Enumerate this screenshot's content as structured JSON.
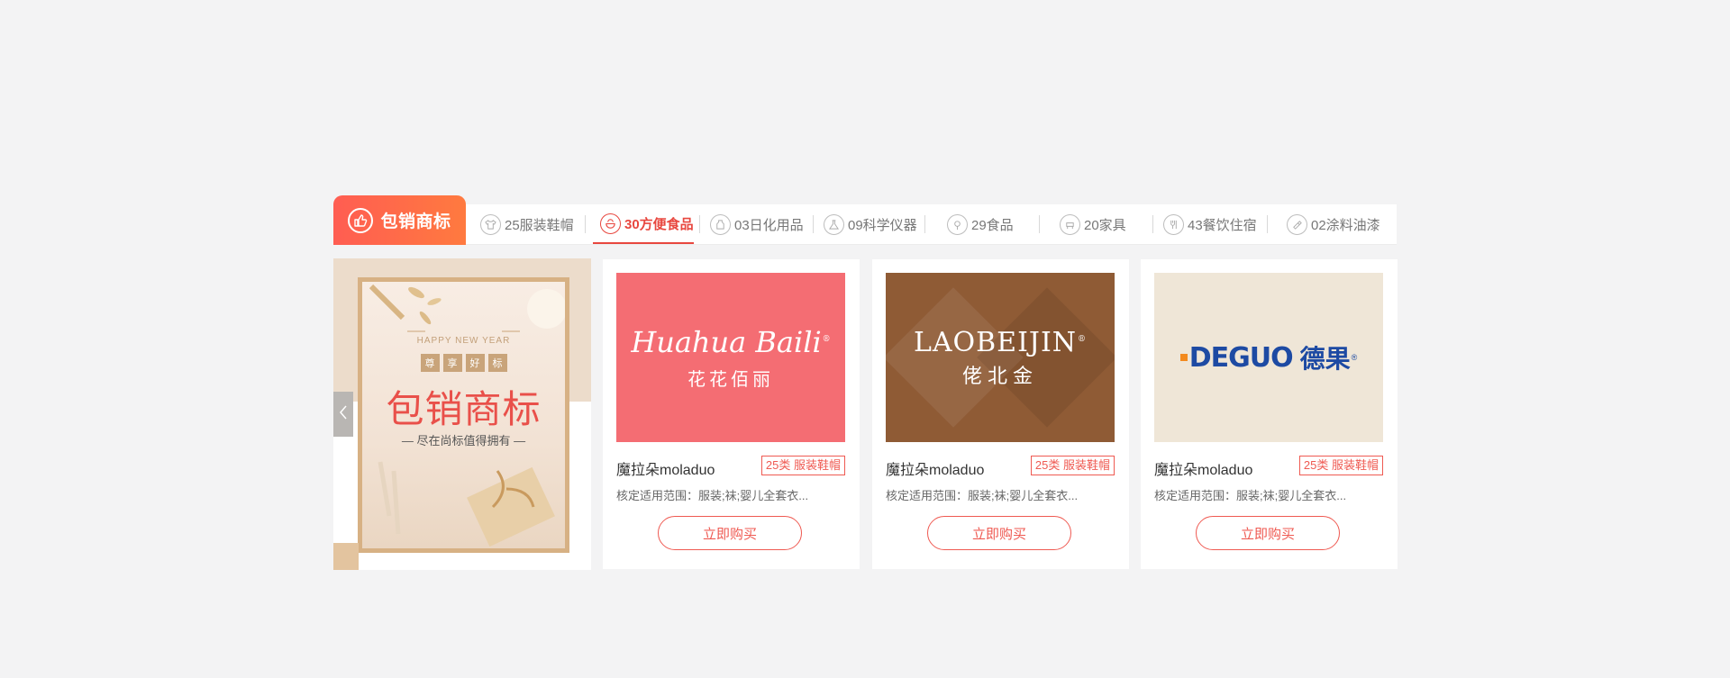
{
  "section": {
    "badge_label": "包销商标",
    "badge_icon": "thumbs-up-icon"
  },
  "tabs": [
    {
      "label": "25服装鞋帽",
      "icon": "shirt-icon",
      "active": false
    },
    {
      "label": "30方便食品",
      "icon": "food-bowl-icon",
      "active": true
    },
    {
      "label": "03日化用品",
      "icon": "bottle-icon",
      "active": false
    },
    {
      "label": "09科学仪器",
      "icon": "flask-icon",
      "active": false
    },
    {
      "label": "29食品",
      "icon": "food-icon",
      "active": false
    },
    {
      "label": "20家具",
      "icon": "furniture-icon",
      "active": false
    },
    {
      "label": "43餐饮住宿",
      "icon": "fork-icon",
      "active": false
    },
    {
      "label": "02涂料油漆",
      "icon": "paint-icon",
      "active": false
    }
  ],
  "banner": {
    "hny": "HAPPY NEW YEAR",
    "enjoy": [
      "尊",
      "享",
      "好",
      "标"
    ],
    "title": "包销商标",
    "subtitle": "— 尽在尚标值得拥有 —"
  },
  "products": [
    {
      "brand_script": "Huahua Baili",
      "brand_cn": "花花佰丽",
      "name": "魔拉朵moladuo",
      "category": "25类 服装鞋帽",
      "scope": "核定适用范围：服装;袜;婴儿全套衣...",
      "buy_label": "立即购买"
    },
    {
      "brand_en": "LAOBEIJIN",
      "brand_cn": "佬北金",
      "name": "魔拉朵moladuo",
      "category": "25类 服装鞋帽",
      "scope": "核定适用范围：服装;袜;婴儿全套衣...",
      "buy_label": "立即购买"
    },
    {
      "brand_en": "DEGUO",
      "brand_cn": "德果",
      "name": "魔拉朵moladuo",
      "category": "25类 服装鞋帽",
      "scope": "核定适用范围：服装;袜;婴儿全套衣...",
      "buy_label": "立即购买"
    }
  ],
  "colors": {
    "accent": "#e8473f",
    "badge_gradient_start": "#ff5d52",
    "badge_gradient_end": "#ff7a3f",
    "page_bg": "#f3f3f4"
  }
}
